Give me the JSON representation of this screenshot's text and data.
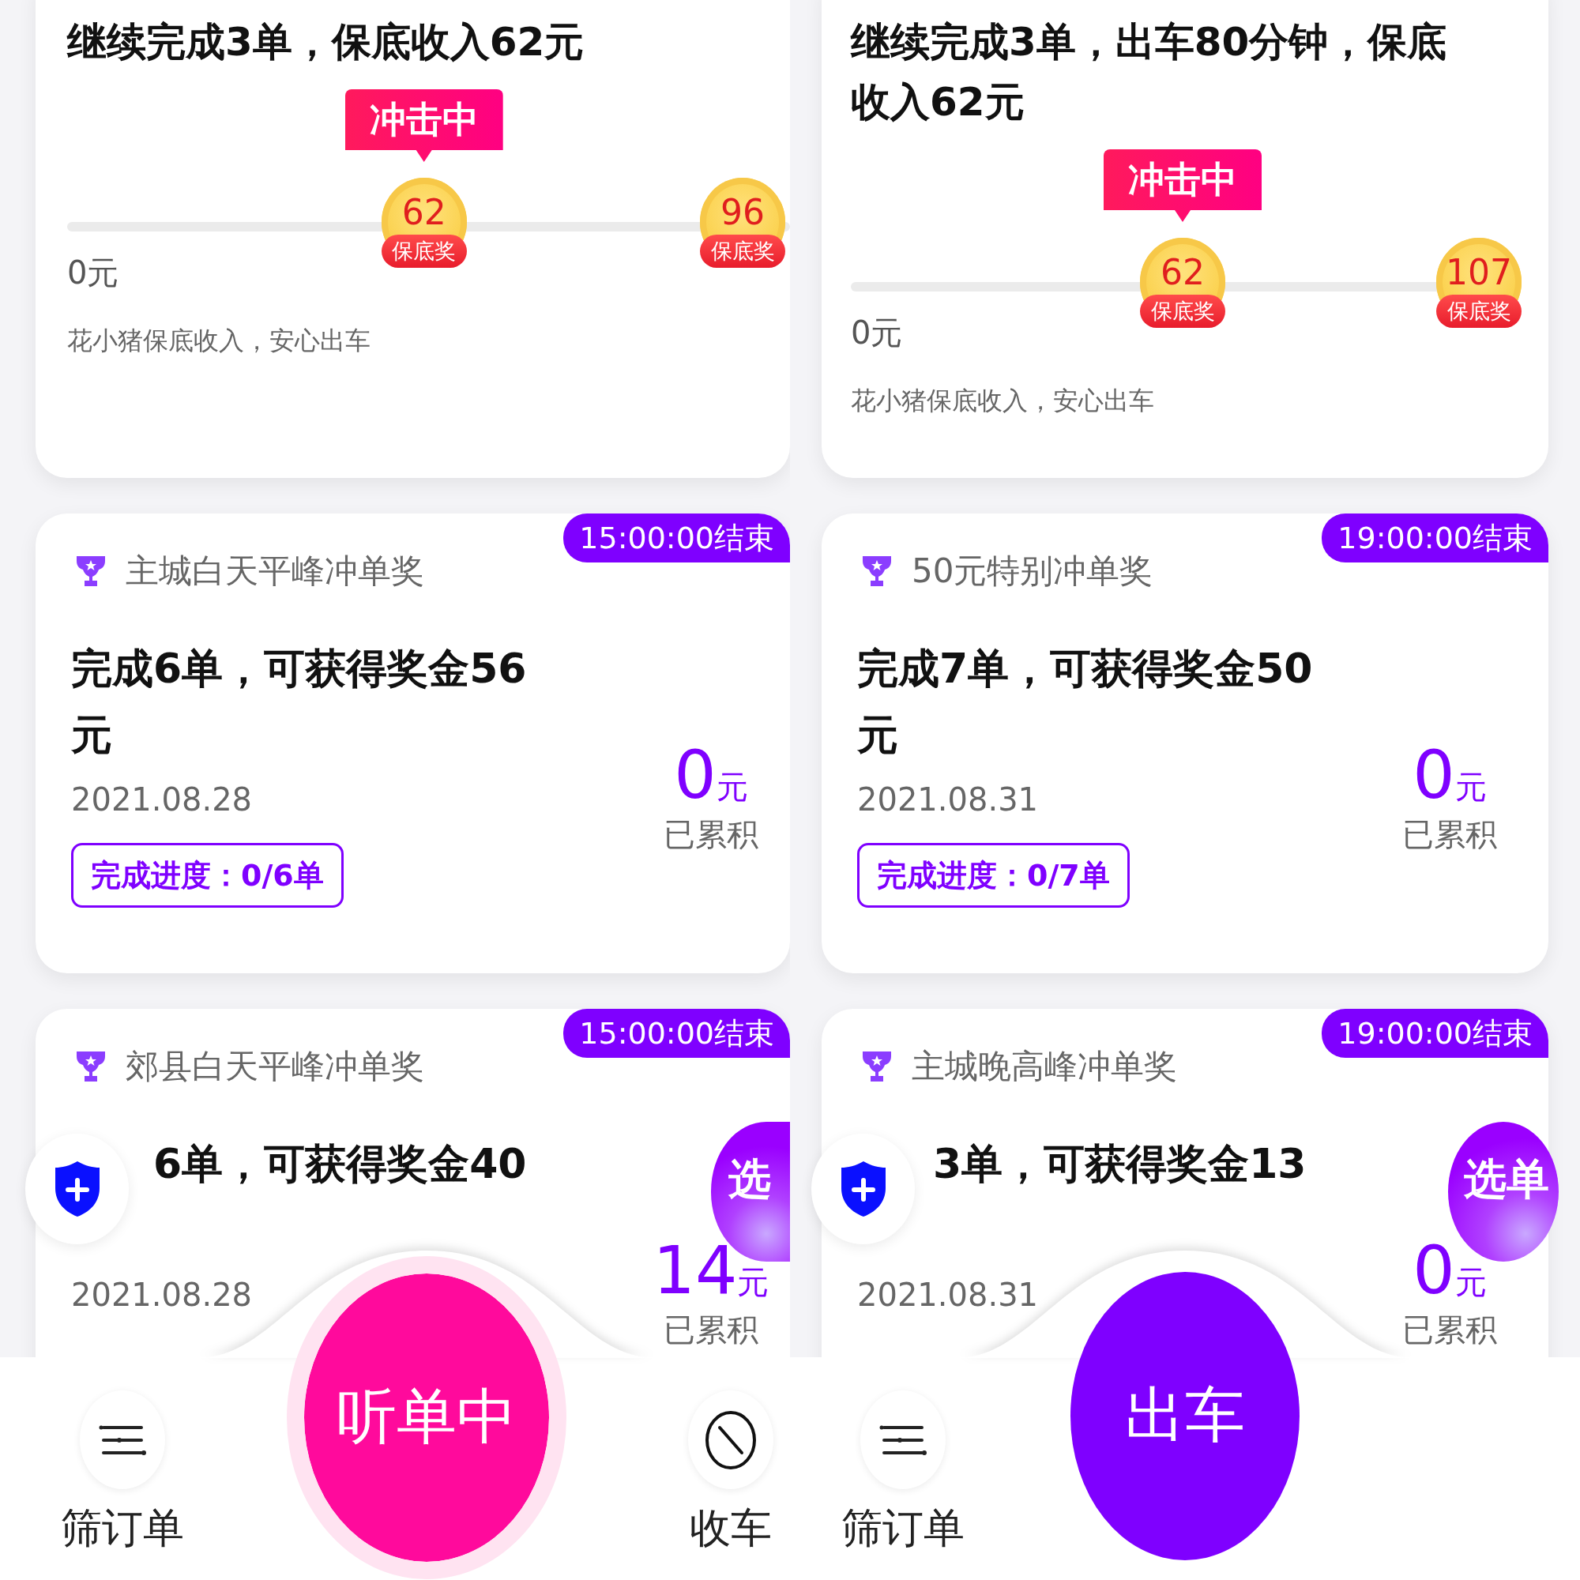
{
  "panels": [
    {
      "guarantee_card": {
        "title": "继续完成3单，保底收入62元",
        "badge": "冲击中",
        "start_label": "0元",
        "milestones": [
          {
            "amount": "62",
            "label": "保底奖",
            "current": true
          },
          {
            "amount": "96",
            "label": "保底奖",
            "current": false
          }
        ],
        "note": "花小猪保底收入，安心出车"
      },
      "reward_cards": [
        {
          "deadline": "15:00:00结束",
          "name": "主城白天平峰冲单奖",
          "goal": "完成6单，可获得奖金56元",
          "date": "2021.08.28",
          "progress": "完成进度：0/6单",
          "amount": "0",
          "unit": "元",
          "caption": "已累积"
        },
        {
          "deadline": "15:00:00结束",
          "name": "郊县白天平峰冲单奖",
          "goal": "6单，可获得奖金40",
          "date": "2021.08.28",
          "amount": "14",
          "unit": "元",
          "caption": "已累积"
        }
      ],
      "pick_button": {
        "label": "选"
      },
      "bottom_bar": {
        "filter": {
          "label": "筛订单"
        },
        "main_button": {
          "kind": "listening",
          "label": "听单中"
        },
        "stop": {
          "label": "收车"
        }
      }
    },
    {
      "guarantee_card": {
        "title": "继续完成3单，出车80分钟，保底收入62元",
        "badge": "冲击中",
        "start_label": "0元",
        "milestones": [
          {
            "amount": "62",
            "label": "保底奖",
            "current": true
          },
          {
            "amount": "107",
            "label": "保底奖",
            "current": false
          }
        ],
        "note": "花小猪保底收入，安心出车"
      },
      "reward_cards": [
        {
          "deadline": "19:00:00结束",
          "name": "50元特别冲单奖",
          "goal": "完成7单，可获得奖金50元",
          "date": "2021.08.31",
          "progress": "完成进度：0/7单",
          "amount": "0",
          "unit": "元",
          "caption": "已累积"
        },
        {
          "deadline": "19:00:00结束",
          "name": "主城晚高峰冲单奖",
          "goal": "3单，可获得奖金13",
          "date": "2021.08.31",
          "amount": "0",
          "unit": "元",
          "caption": "已累积"
        }
      ],
      "pick_button": {
        "label": "选单"
      },
      "bottom_bar": {
        "filter": {
          "label": "筛订单"
        },
        "main_button": {
          "kind": "online",
          "label": "出车"
        }
      }
    }
  ]
}
